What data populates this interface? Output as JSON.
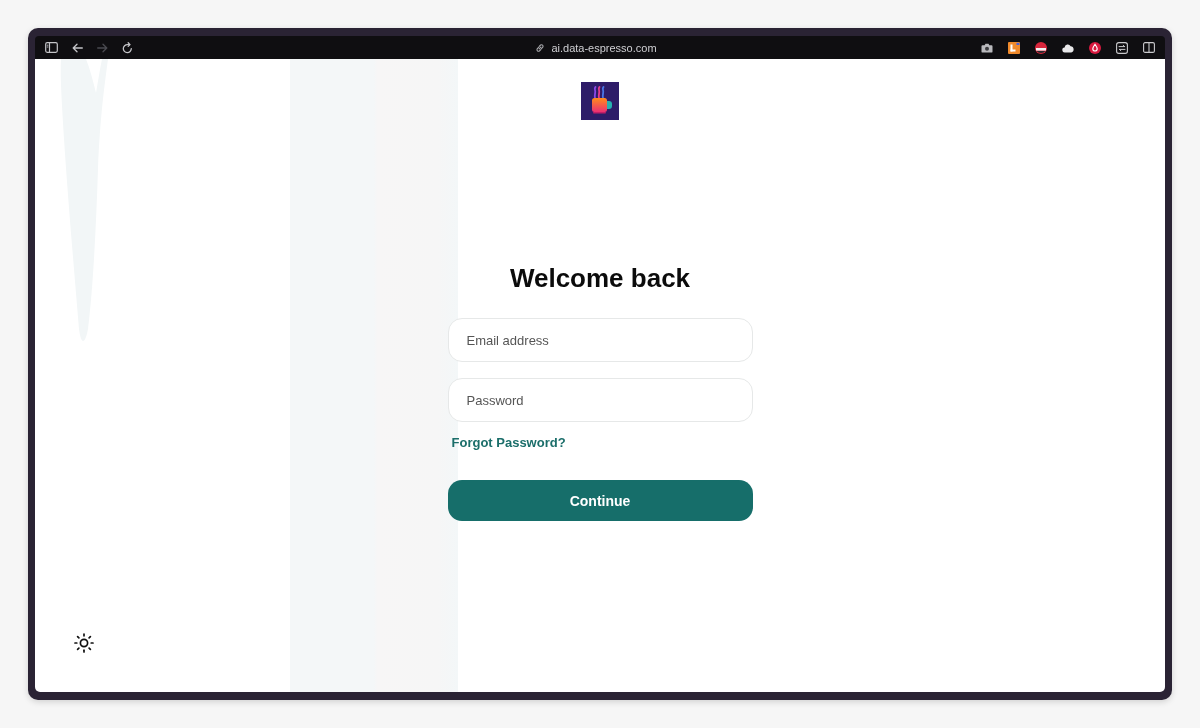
{
  "toolbar": {
    "nav_buttons": [
      {
        "kind": "sidebar",
        "disabled": false
      },
      {
        "kind": "back",
        "disabled": false
      },
      {
        "kind": "forward",
        "disabled": true
      },
      {
        "kind": "reload",
        "disabled": false
      }
    ],
    "url": "ai.data-espresso.com"
  },
  "login": {
    "title": "Welcome back",
    "fields": [
      {
        "placeholder": "Email address"
      },
      {
        "placeholder": "Password"
      }
    ],
    "forgot_link": "Forgot Password?",
    "submit_button": "Continue"
  }
}
